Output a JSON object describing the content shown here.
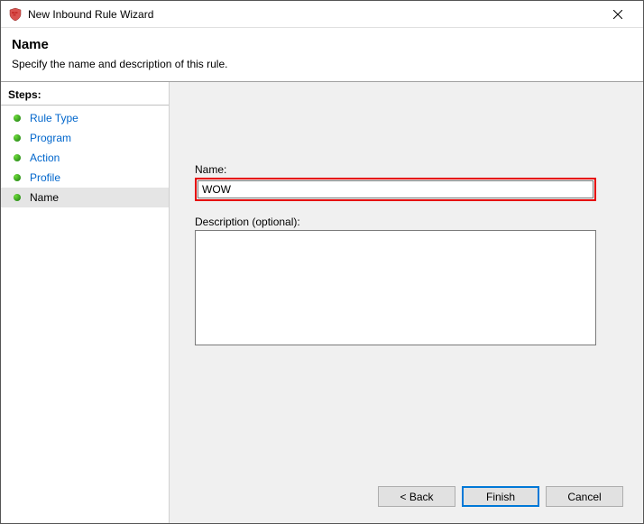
{
  "titlebar": {
    "title": "New Inbound Rule Wizard"
  },
  "header": {
    "title": "Name",
    "subtitle": "Specify the name and description of this rule."
  },
  "sidebar": {
    "header": "Steps:",
    "items": [
      {
        "label": "Rule Type"
      },
      {
        "label": "Program"
      },
      {
        "label": "Action"
      },
      {
        "label": "Profile"
      },
      {
        "label": "Name"
      }
    ]
  },
  "main": {
    "name_label": "Name:",
    "name_value": "WOW",
    "desc_label": "Description (optional):",
    "desc_value": ""
  },
  "buttons": {
    "back": "< Back",
    "finish": "Finish",
    "cancel": "Cancel"
  }
}
